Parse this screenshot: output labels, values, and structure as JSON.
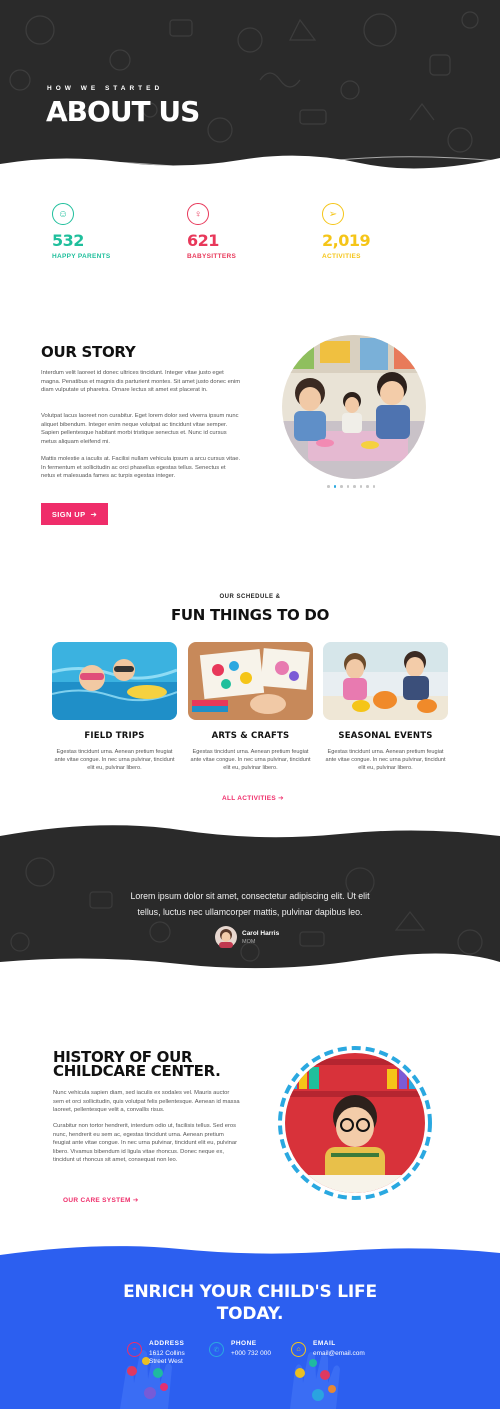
{
  "hero": {
    "kicker": "HOW WE STARTED",
    "title": "ABOUT US"
  },
  "stats": [
    {
      "icon": "smiley-icon",
      "glyph": "☺",
      "number": "532",
      "label": "HAPPY PARENTS",
      "color": "#1fbf9c"
    },
    {
      "icon": "person-icon",
      "glyph": "♀",
      "number": "621",
      "label": "BABYSITTERS",
      "color": "#e8385a"
    },
    {
      "icon": "paper-plane-icon",
      "glyph": "➢",
      "number": "2,019",
      "label": "ACTIVITIES",
      "color": "#f5c518"
    }
  ],
  "story": {
    "title": "OUR STORY",
    "p1": "Interdum velit laoreet id donec ultrices tincidunt. Integer vitae justo eget magna. Penatibus et magnis dis parturient montes. Sit amet justo donec enim diam vulputate ut pharetra. Ornare lectus sit amet est placerat in.",
    "p2": "Volutpat lacus laoreet non curabitur. Eget lorem dolor sed viverra ipsum nunc aliquet bibendum. Integer enim neque volutpat ac tincidunt vitae semper. Sapien pellentesque habitant morbi tristique senectus et. Nunc id cursus metus aliquam eleifend mi.",
    "p3": "Mattis molestie a iaculis at. Facilisi nullam vehicula ipsum a arcu cursus vitae. In fermentum et sollicitudin ac orci phasellus egestas tellus. Senectus et netus et malesuada fames ac turpis egestas integer.",
    "button": "SIGN UP",
    "button_icon": "➔",
    "slider_dots": 8,
    "slider_active": 1
  },
  "fun": {
    "kicker": "OUR SCHEDULE &",
    "title": "FUN THINGS TO DO",
    "cards": [
      {
        "title": "FIELD TRIPS",
        "text": "Egestas tincidunt urna. Aenean pretium feugiat ante vitae congue. In nec urna pulvinar, tincidunt elit eu, pulvinar libero."
      },
      {
        "title": "ARTS & CRAFTS",
        "text": "Egestas tincidunt urna. Aenean pretium feugiat ante vitae congue. In nec urna pulvinar, tincidunt elit eu, pulvinar libero."
      },
      {
        "title": "SEASONAL EVENTS",
        "text": "Egestas tincidunt urna. Aenean pretium feugiat ante vitae congue. In nec urna pulvinar, tincidunt elit eu, pulvinar libero."
      }
    ],
    "link": "ALL ACTIVITIES",
    "link_icon": "➔"
  },
  "testimonial": {
    "line1": "Lorem ipsum dolor sit amet, consectetur adipiscing elit. Ut elit",
    "line2": "tellus, luctus nec ullamcorper mattis, pulvinar dapibus leo.",
    "name": "Carol Harris",
    "role": "MOM"
  },
  "history": {
    "title_line1": "HISTORY OF OUR",
    "title_line2": "CHILDCARE CENTER.",
    "p1": "Nunc vehicula sapien diam, sed iaculis ex sodales vel. Mauris auctor sem et orci sollicitudin, quis volutpat felis pellentesque. Aenean id massa laoreet, pellentesque velit a, convallis risus.",
    "p2": "Curabitur non tortor hendrerit, interdum odio ut, facilisis tellus. Sed eros nunc, hendrerit eu sem ac, egestas tincidunt urna. Aenean pretium feugiat ante vitae congue. In nec urna pulvinar, tincidunt elit eu, pulvinar libero. Vivamus bibendum id ligula vitae rhoncus. Donec neque ex, tincidunt ut rhoncus sit amet, consequat non leo.",
    "link": "OUR CARE SYSTEM",
    "link_icon": "➔"
  },
  "footer": {
    "title_line1": "ENRICH YOUR CHILD'S LIFE",
    "title_line2": "TODAY.",
    "contacts": [
      {
        "icon": "location-pin-icon",
        "glyph": "⌖",
        "title": "ADDRESS",
        "value_line1": "1612 Collins",
        "value_line2": "Street West",
        "color": "#ef2d6a"
      },
      {
        "icon": "phone-icon",
        "glyph": "✆",
        "title": "PHONE",
        "value_line1": "+000 732 000",
        "value_line2": "",
        "color": "#2aa8e0"
      },
      {
        "icon": "home-icon",
        "glyph": "⌂",
        "title": "EMAIL",
        "value_line1": "email@email.com",
        "value_line2": "",
        "color": "#f5c518"
      }
    ]
  },
  "colors": {
    "dark": "#2a2a2a",
    "pink": "#ef2d6a",
    "teal": "#1fbf9c",
    "red": "#e8385a",
    "yellow": "#f5c518",
    "blue": "#2c5ff0",
    "sky": "#2aa8e0"
  }
}
